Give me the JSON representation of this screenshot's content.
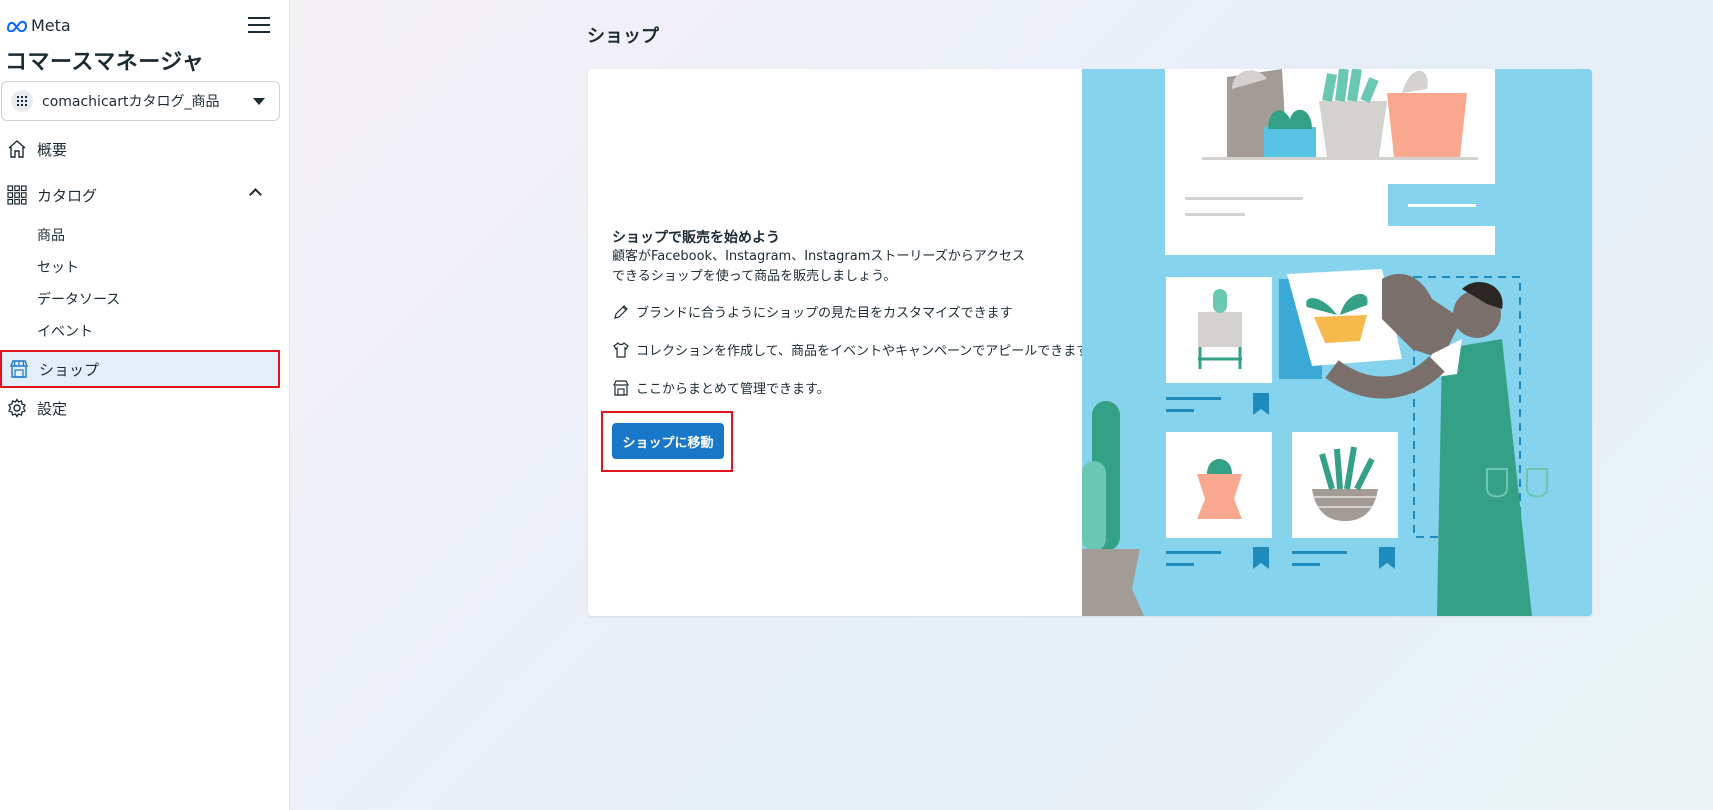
{
  "brand": {
    "logo_text": "Meta"
  },
  "app": {
    "title": "コマースマネージャ"
  },
  "catalog_selector": {
    "selected": "comachicartカタログ_商品"
  },
  "nav": {
    "overview": "概要",
    "catalog": "カタログ",
    "catalog_sub": [
      "商品",
      "セット",
      "データソース",
      "イベント"
    ],
    "shop": "ショップ",
    "settings": "設定"
  },
  "page": {
    "title": "ショップ"
  },
  "card": {
    "heading": "ショップで販売を始めよう",
    "description": "顧客がFacebook、Instagram、Instagramストーリーズからアクセスできるショップを使って商品を販売しましょう。",
    "features": [
      {
        "icon": "pencil-icon",
        "text": "ブランドに合うようにショップの見た目をカスタマイズできます"
      },
      {
        "icon": "shirt-icon",
        "text": "コレクションを作成して、商品をイベントやキャンペーンでアピールできます"
      },
      {
        "icon": "storefront-icon",
        "text": "ここからまとめて管理できます。"
      }
    ],
    "cta_label": "ショップに移動"
  },
  "colors": {
    "accent": "#1877c9",
    "highlight": "#e0141e",
    "active_bg": "#e4eef8",
    "illustration_bg": "#86d3ee"
  }
}
